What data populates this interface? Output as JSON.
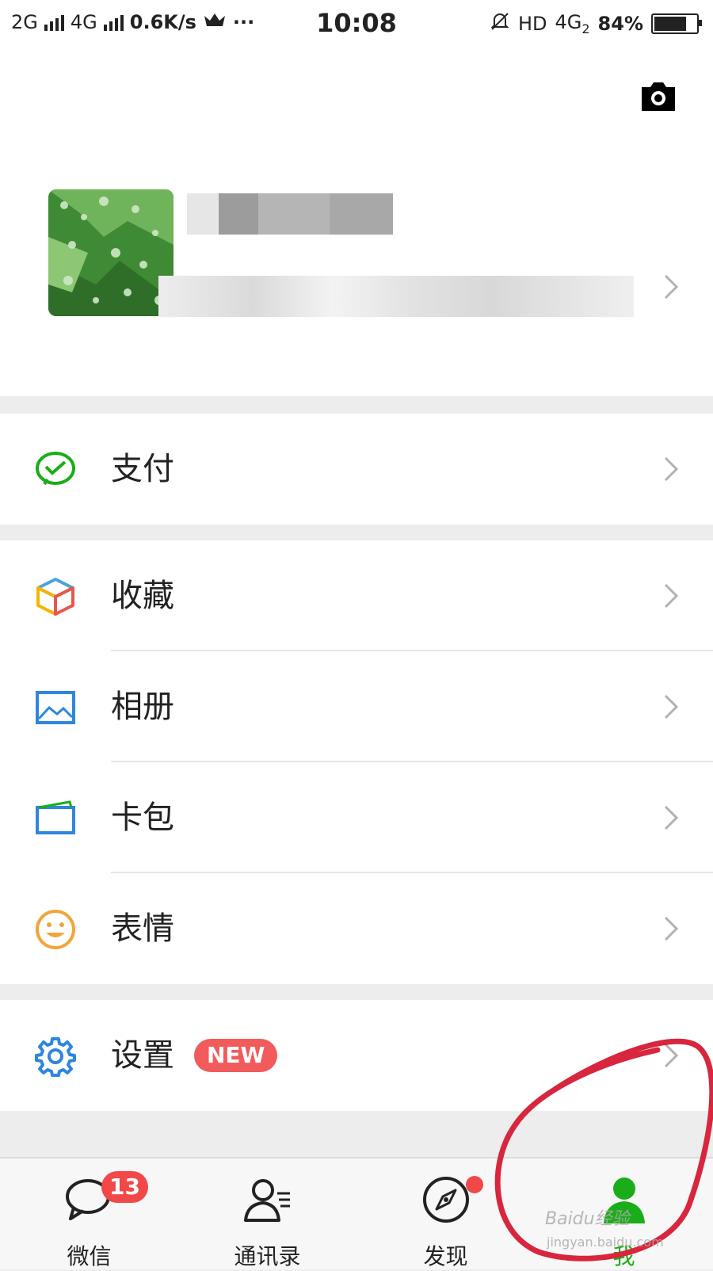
{
  "status_bar": {
    "network1": "2G",
    "network2": "4G",
    "speed": "0.6K/s",
    "more": "···",
    "time": "10:08",
    "hd": "HD",
    "network3": "4G",
    "sim": "2",
    "battery_text": "84%",
    "battery_level": 0.84
  },
  "profile": {
    "name": "████████",
    "wechat_id": "████████████████"
  },
  "menu": {
    "pay": "支付",
    "favorites": "收藏",
    "album": "相册",
    "card_wallet": "卡包",
    "stickers": "表情",
    "settings": "设置",
    "settings_badge": "NEW"
  },
  "tabs": {
    "chats": "微信",
    "chats_badge": "13",
    "contacts": "通讯录",
    "discover": "发现",
    "me": "我"
  },
  "watermark": {
    "brand": "Baidu经验",
    "url": "jingyan.baidu.com"
  },
  "colors": {
    "accent_green": "#1aad19",
    "badge_red": "#f34848",
    "annotation_red": "#d7263d"
  }
}
